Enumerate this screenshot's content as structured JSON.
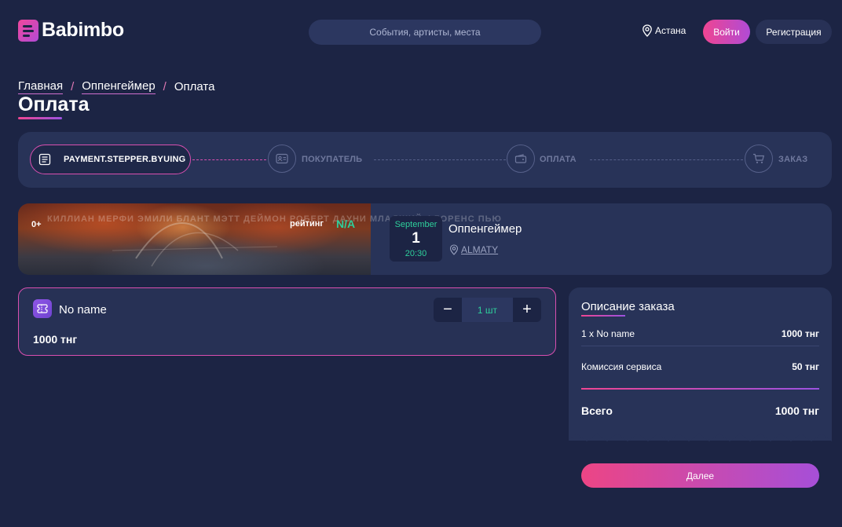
{
  "header": {
    "brand": "Babimbo",
    "search_placeholder": "События, артисты, места",
    "city": "Астана",
    "login_label": "Войти",
    "register_label": "Регистрация"
  },
  "breadcrumbs": [
    "Главная",
    "Оппенгеймер",
    "Оплата"
  ],
  "page_title": "Оплата",
  "stepper": {
    "steps": [
      {
        "label": "PAYMENT.STEPPER.BYUING",
        "icon": "list-icon",
        "active": true
      },
      {
        "label": "ПОКУПАТЕЛЬ",
        "icon": "id-card-icon",
        "active": false
      },
      {
        "label": "ОПЛАТА",
        "icon": "wallet-icon",
        "active": false
      },
      {
        "label": "ЗАКАЗ",
        "icon": "cart-icon",
        "active": false
      }
    ]
  },
  "event": {
    "age": "0+",
    "poster_names": "КИЛЛИАН МЕРФИ   ЭМИЛИ БЛАНТ   МЭТТ ДЕЙМОН   РОБЕРТ ДАУНИ МЛАДШИЙ   ФЛОРЕНС ПЬЮ",
    "rating_label": "рейтинг",
    "rating_value": "N/A",
    "date_month": "September",
    "date_day": "1",
    "date_time": "20:30",
    "title": "Оппенгеймер",
    "place": "ALMATY"
  },
  "ticket": {
    "name": "No name",
    "price": "1000 тнг",
    "quantity": "1 шт",
    "minus": "−",
    "plus": "+"
  },
  "summary": {
    "title": "Описание заказа",
    "rows": [
      {
        "label": "1 x No name",
        "value": "1000 тнг"
      },
      {
        "label": "Комиссия сервиса",
        "value": "50 тнг"
      }
    ],
    "total_label": "Всего",
    "total_value": "1000 тнг",
    "next_label": "Далее"
  },
  "colors": {
    "background": "#1c2444",
    "panel": "#283358",
    "accent_pink": "#ef4592",
    "accent_purple": "#a64fd8",
    "accent_green": "#2ecf9b"
  }
}
